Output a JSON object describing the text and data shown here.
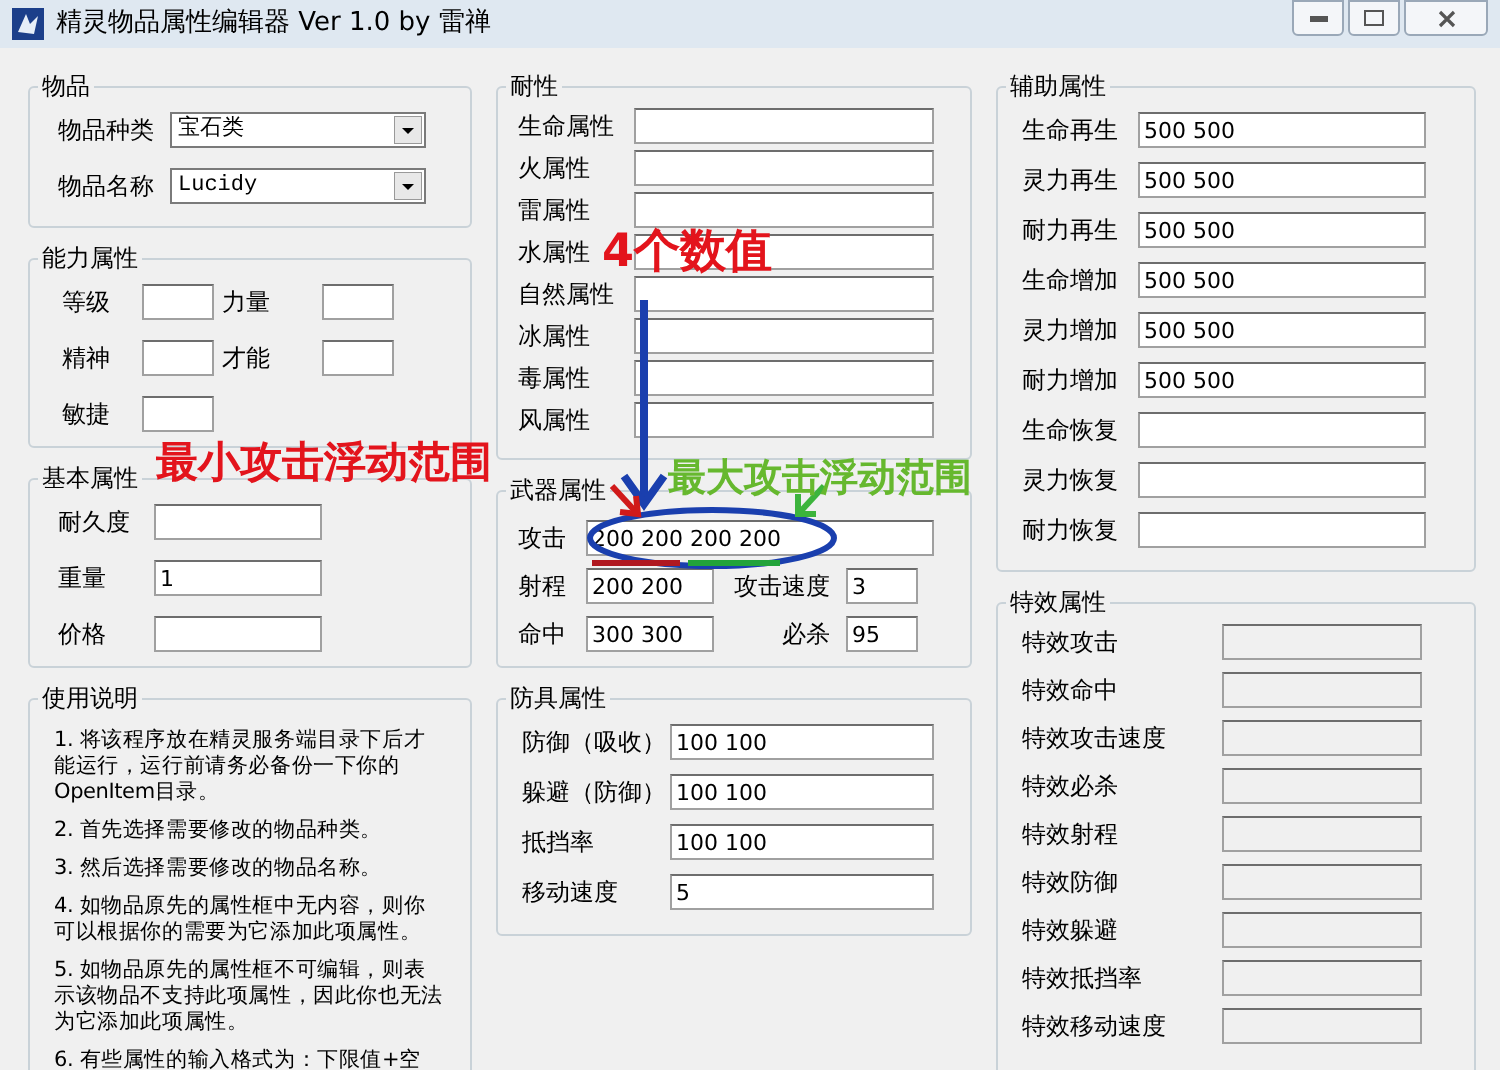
{
  "window": {
    "title": "精灵物品属性编辑器 Ver 1.0 by 雷禅"
  },
  "item": {
    "title": "物品",
    "combos": [
      {
        "label": "物品种类",
        "value": "宝石类"
      },
      {
        "label": "物品名称",
        "value": "Lucidy"
      }
    ]
  },
  "ability": {
    "title": "能力属性",
    "fields": [
      {
        "label": "等级"
      },
      {
        "label": "力量"
      },
      {
        "label": "精神"
      },
      {
        "label": "才能"
      },
      {
        "label": "敏捷"
      }
    ]
  },
  "basic": {
    "title": "基本属性",
    "fields": [
      {
        "label": "耐久度"
      },
      {
        "label": "重量",
        "value": "1"
      },
      {
        "label": "价格"
      }
    ]
  },
  "help": {
    "title": "使用说明",
    "paragraphs": [
      "1. 将该程序放在精灵服务端目录下后才能运行，运行前请务必备份一下你的OpenItem目录。",
      "2. 首先选择需要修改的物品种类。",
      "3. 然后选择需要修改的物品名称。",
      "4. 如物品原先的属性框中无内容，则你可以根据你的需要为它添加此项属性。",
      "5. 如物品原先的属性框不可编辑，则表示该物品不支持此项属性，因此你也无法为它添加此项属性。",
      "6. 有些属性的输入格式为：下限值+空"
    ]
  },
  "resistance": {
    "title": "耐性",
    "fields": [
      {
        "label": "生命属性"
      },
      {
        "label": "火属性"
      },
      {
        "label": "雷属性"
      },
      {
        "label": "水属性"
      },
      {
        "label": "自然属性"
      },
      {
        "label": "冰属性"
      },
      {
        "label": "毒属性"
      },
      {
        "label": "风属性"
      }
    ]
  },
  "weapon": {
    "title": "武器属性",
    "attack": {
      "label": "攻击",
      "value": "200 200 200 200"
    },
    "range": {
      "label": "射程",
      "value": "200 200"
    },
    "attack_speed": {
      "label": "攻击速度",
      "value": "3"
    },
    "hit": {
      "label": "命中",
      "value": "300 300"
    },
    "critical": {
      "label": "必杀",
      "value": "95"
    }
  },
  "armor": {
    "title": "防具属性",
    "fields": [
      {
        "label": "防御（吸收）",
        "value": "100 100"
      },
      {
        "label": "躲避（防御）",
        "value": "100 100"
      },
      {
        "label": "抵挡率",
        "value": "100 100"
      },
      {
        "label": "移动速度",
        "value": "5"
      }
    ]
  },
  "auxiliary": {
    "title": "辅助属性",
    "fields": [
      {
        "label": "生命再生",
        "value": "500 500"
      },
      {
        "label": "灵力再生",
        "value": "500 500"
      },
      {
        "label": "耐力再生",
        "value": "500 500"
      },
      {
        "label": "生命增加",
        "value": "500 500"
      },
      {
        "label": "灵力增加",
        "value": "500 500"
      },
      {
        "label": "耐力增加",
        "value": "500 500"
      },
      {
        "label": "生命恢复"
      },
      {
        "label": "灵力恢复"
      },
      {
        "label": "耐力恢复"
      }
    ]
  },
  "effects": {
    "title": "特效属性",
    "fields": [
      {
        "label": "特效攻击",
        "disabled": true
      },
      {
        "label": "特效命中",
        "disabled": true
      },
      {
        "label": "特效攻击速度",
        "disabled": true
      },
      {
        "label": "特效必杀",
        "disabled": true
      },
      {
        "label": "特效射程",
        "disabled": true
      },
      {
        "label": "特效防御",
        "disabled": true
      },
      {
        "label": "特效躲避",
        "disabled": true
      },
      {
        "label": "特效抵挡率",
        "disabled": true
      },
      {
        "label": "特效移动速度",
        "disabled": true
      }
    ]
  },
  "annotations": [
    {
      "text": "4个数值",
      "color": "#e3141c"
    },
    {
      "text": "最小攻击浮动范围",
      "color": "#e3141c"
    },
    {
      "text": "最大攻击浮动范围",
      "color": "#66b82e"
    }
  ]
}
